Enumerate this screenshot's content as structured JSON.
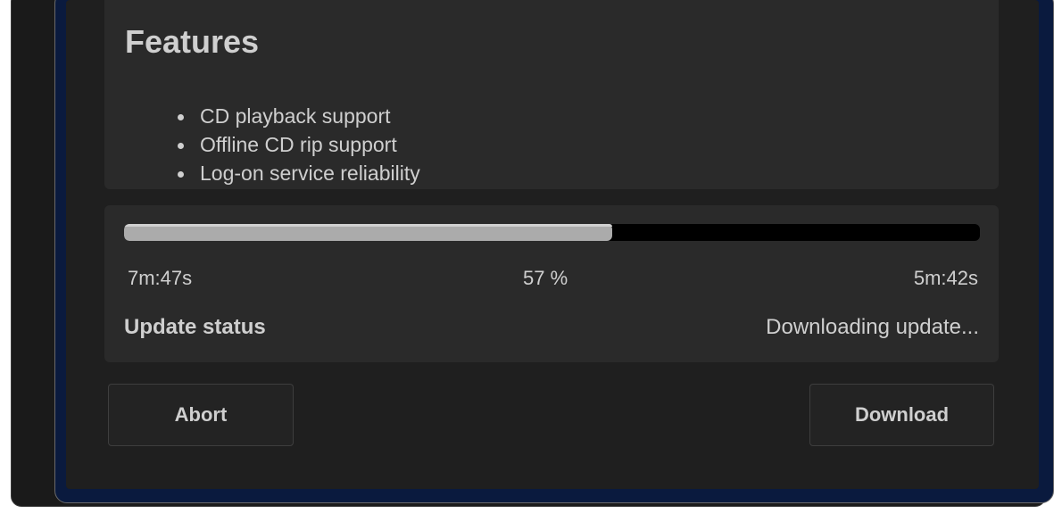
{
  "features": {
    "title": "Features",
    "items": [
      "CD playback support",
      "Offline CD rip support",
      "Log-on service reliability"
    ]
  },
  "progress": {
    "percent_value": 57,
    "percent_label": "57 %",
    "elapsed": "7m:47s",
    "remaining": "5m:42s"
  },
  "status": {
    "label": "Update status",
    "value": "Downloading update..."
  },
  "buttons": {
    "abort_label": "Abort",
    "download_label": "Download"
  },
  "colors": {
    "background": "#1f1f1f",
    "panel": "#2a2a2a",
    "progress_fill": "#ababab",
    "progress_track": "#000000",
    "text": "#cfcfcf",
    "window_border": "#0a1a3e"
  }
}
